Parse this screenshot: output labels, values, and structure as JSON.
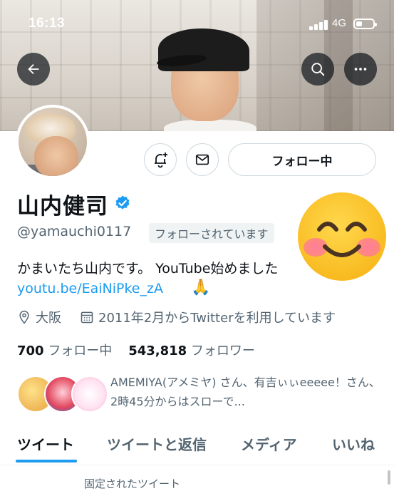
{
  "status_bar": {
    "time": "16:13",
    "network": "4G",
    "signal_bars": 4,
    "battery_level": 0.35
  },
  "nav": {
    "back_icon": "arrow-left-icon",
    "search_icon": "search-icon",
    "more_icon": "more-horizontal-icon"
  },
  "profile": {
    "name": "山内健司",
    "handle": "@yamauchi0117",
    "follows_you": "フォローされています",
    "bio_line1": "かまいたち山内です。 YouTube始めました",
    "bio_link": "youtu.be/EaiNiPke_zA",
    "bio_emoji": "🙏",
    "location": "大阪",
    "joined": "2011年2月からTwitterを利用しています",
    "following_count": "700",
    "following_label": "フォロー中",
    "followers_count": "543,818",
    "followers_label": "フォロワー",
    "mutual_followers": "AMEMIYA(アメミヤ) さん、有吉ぃぃeeeee！さん、2時45分からはスローで..."
  },
  "actions": {
    "notify_icon": "bell-plus-icon",
    "message_icon": "mail-icon",
    "follow_label": "フォロー中"
  },
  "tabs": [
    {
      "label": "ツイート",
      "active": true
    },
    {
      "label": "ツイートと返信",
      "active": false
    },
    {
      "label": "メディア",
      "active": false
    },
    {
      "label": "いいね",
      "active": false
    }
  ],
  "pinned_label": "固定されたツイート",
  "colors": {
    "accent": "#1d9bf0",
    "text": "#0f1419",
    "muted": "#536471",
    "sticker": "#f8b91e"
  }
}
